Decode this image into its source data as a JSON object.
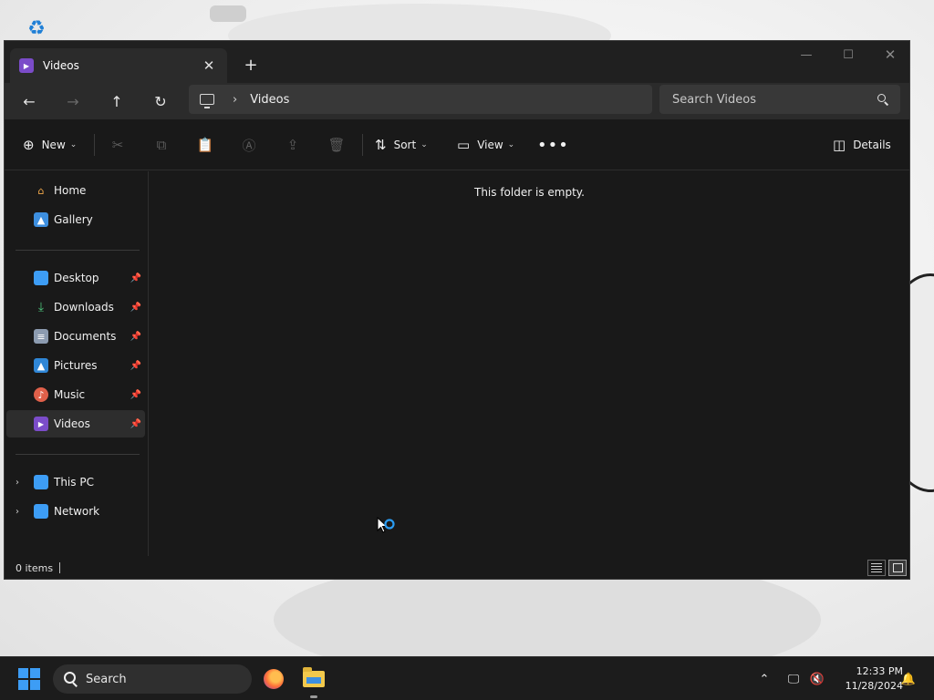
{
  "window": {
    "tab_title": "Videos",
    "tab_icon": "videos-folder-icon",
    "accent": "#7b4cc9"
  },
  "navbar": {
    "breadcrumb": [
      "Videos"
    ],
    "search_placeholder": "Search Videos"
  },
  "toolbar": {
    "new_label": "New",
    "sort_label": "Sort",
    "view_label": "View",
    "details_label": "Details",
    "disabled_actions": [
      "cut-icon",
      "copy-icon",
      "paste-icon",
      "rename-icon",
      "share-icon",
      "delete-icon"
    ]
  },
  "sidebar": {
    "quick": [
      {
        "label": "Home",
        "icon": "home-icon"
      },
      {
        "label": "Gallery",
        "icon": "gallery-icon"
      }
    ],
    "pinned": [
      {
        "label": "Desktop",
        "icon": "desktop-icon"
      },
      {
        "label": "Downloads",
        "icon": "downloads-icon"
      },
      {
        "label": "Documents",
        "icon": "documents-icon"
      },
      {
        "label": "Pictures",
        "icon": "pictures-icon"
      },
      {
        "label": "Music",
        "icon": "music-icon"
      },
      {
        "label": "Videos",
        "icon": "videos-icon",
        "selected": true
      }
    ],
    "locations": [
      {
        "label": "This PC",
        "icon": "this-pc-icon"
      },
      {
        "label": "Network",
        "icon": "network-icon"
      }
    ]
  },
  "content": {
    "empty_message": "This folder is empty."
  },
  "status": {
    "item_count": "0 items"
  },
  "taskbar": {
    "search_label": "Search",
    "time": "12:33 PM",
    "date": "11/28/2024"
  }
}
